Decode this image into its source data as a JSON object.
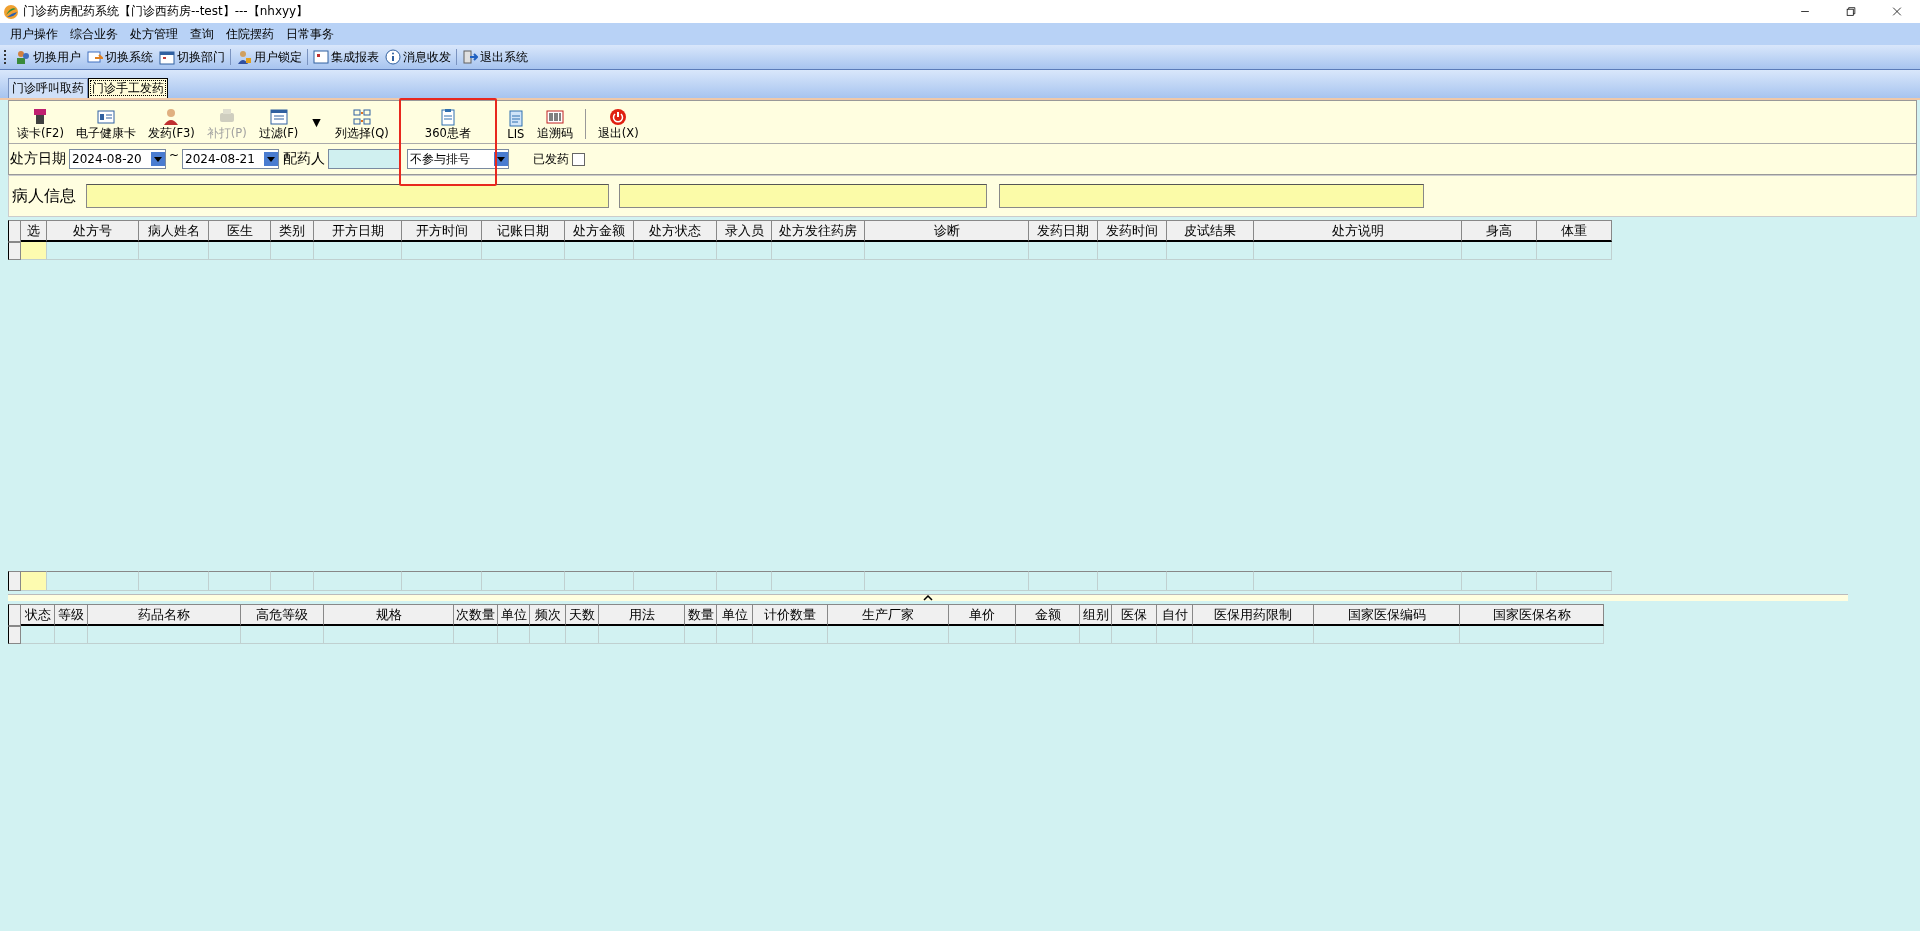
{
  "window": {
    "title": "门诊药房配药系统【门诊西药房--test】---【nhxyy】"
  },
  "menu": [
    "用户操作",
    "综合业务",
    "处方管理",
    "查询",
    "住院摆药",
    "日常事务"
  ],
  "quick_toolbar": [
    {
      "kind": "button",
      "label": "切换用户"
    },
    {
      "kind": "button",
      "label": "切换系统"
    },
    {
      "kind": "button",
      "label": "切换部门"
    },
    {
      "kind": "separator"
    },
    {
      "kind": "button",
      "label": "用户锁定"
    },
    {
      "kind": "separator"
    },
    {
      "kind": "button",
      "label": "集成报表"
    },
    {
      "kind": "button",
      "label": "消息收发"
    },
    {
      "kind": "separator"
    },
    {
      "kind": "button",
      "label": "退出系统"
    }
  ],
  "tabs": [
    {
      "label": "门诊呼叫取药",
      "selected": false
    },
    {
      "label": "门诊手工发药",
      "selected": true
    }
  ],
  "toolbar": [
    {
      "kind": "button",
      "label": "读卡(F2)",
      "disabled": false,
      "highlighted": false
    },
    {
      "kind": "button",
      "label": "电子健康卡",
      "disabled": false,
      "highlighted": false
    },
    {
      "kind": "button",
      "label": "发药(F3)",
      "disabled": false,
      "highlighted": false
    },
    {
      "kind": "button",
      "label": "补打(P)",
      "disabled": true,
      "highlighted": false
    },
    {
      "kind": "button",
      "label": "过滤(F)",
      "disabled": false,
      "highlighted": false
    },
    {
      "kind": "dropdown",
      "label": "▼"
    },
    {
      "kind": "button",
      "label": "列选择(Q)",
      "disabled": false,
      "highlighted": false
    },
    {
      "kind": "button",
      "label": "360患者",
      "disabled": false,
      "highlighted": true
    },
    {
      "kind": "button",
      "label": "LIS",
      "disabled": false,
      "highlighted": false
    },
    {
      "kind": "button",
      "label": "追溯码",
      "disabled": false,
      "highlighted": false
    },
    {
      "kind": "separator"
    },
    {
      "kind": "button",
      "label": "退出(X)",
      "disabled": false,
      "highlighted": false
    }
  ],
  "filter": {
    "date_label": "处方日期",
    "date_from": "2024-08-20",
    "range_sep": "~",
    "date_to": "2024-08-21",
    "dispenser_label": "配药人",
    "queue_option": "不参与排号",
    "dispensed_label": "已发药",
    "dispensed_checked": false
  },
  "patient_info": {
    "label": "病人信息"
  },
  "prescription_table": {
    "columns": [
      "选",
      "处方号",
      "病人姓名",
      "医生",
      "类别",
      "开方日期",
      "开方时间",
      "记账日期",
      "处方金额",
      "处方状态",
      "录入员",
      "处方发往药房",
      "诊断",
      "发药日期",
      "发药时间",
      "皮试结果",
      "处方说明",
      "身高",
      "体重"
    ]
  },
  "drug_table": {
    "columns": [
      "状态",
      "等级",
      "药品名称",
      "高危等级",
      "规格",
      "次数量",
      "单位",
      "频次",
      "天数",
      "用法",
      "数量",
      "单位",
      "计价数量",
      "生产厂家",
      "单价",
      "金额",
      "组别",
      "医保",
      "自付",
      "医保用药限制",
      "国家医保编码",
      "国家医保名称"
    ]
  }
}
